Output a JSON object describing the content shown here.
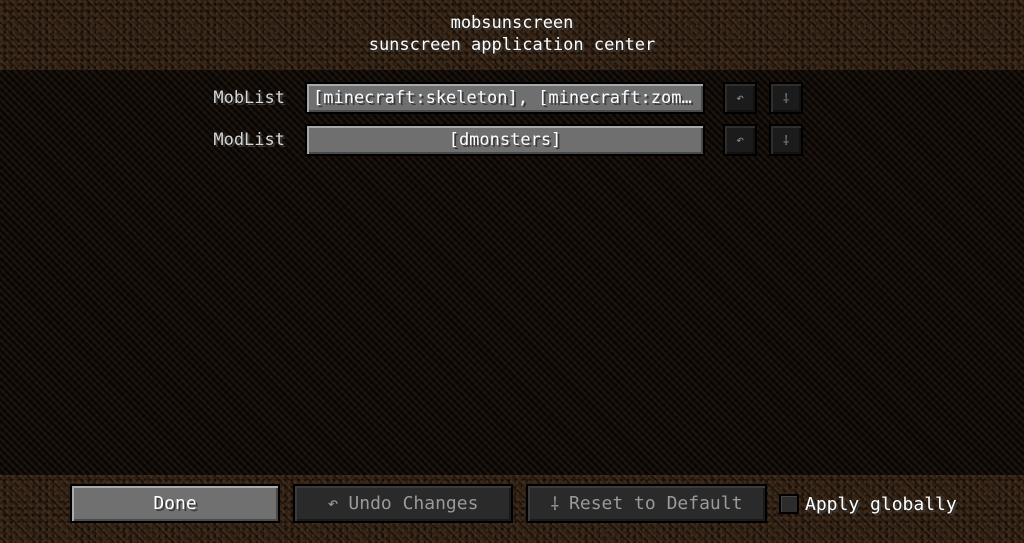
{
  "header": {
    "title": "mobsunscreen",
    "subtitle": "sunscreen application center"
  },
  "config_rows": [
    {
      "label": "MobList",
      "value": "[minecraft:skeleton], [minecraft:zom…",
      "undo_icon": "↶",
      "reset_icon": "⸸"
    },
    {
      "label": "ModList",
      "value": "[dmonsters]",
      "undo_icon": "↶",
      "reset_icon": "⸸"
    }
  ],
  "footer": {
    "done_label": "Done",
    "undo_icon": "↶",
    "undo_label": "Undo Changes",
    "reset_icon": "⸸",
    "reset_label": "Reset to Default",
    "apply_globally_label": "Apply globally",
    "apply_globally_checked": false
  },
  "icons": {
    "undo": "undo-arrow-icon",
    "reset": "reset-dagger-icon"
  },
  "colors": {
    "button_face": "#6f6f6f",
    "disabled_button_face": "#2a2a2a",
    "text": "#ffffff"
  }
}
